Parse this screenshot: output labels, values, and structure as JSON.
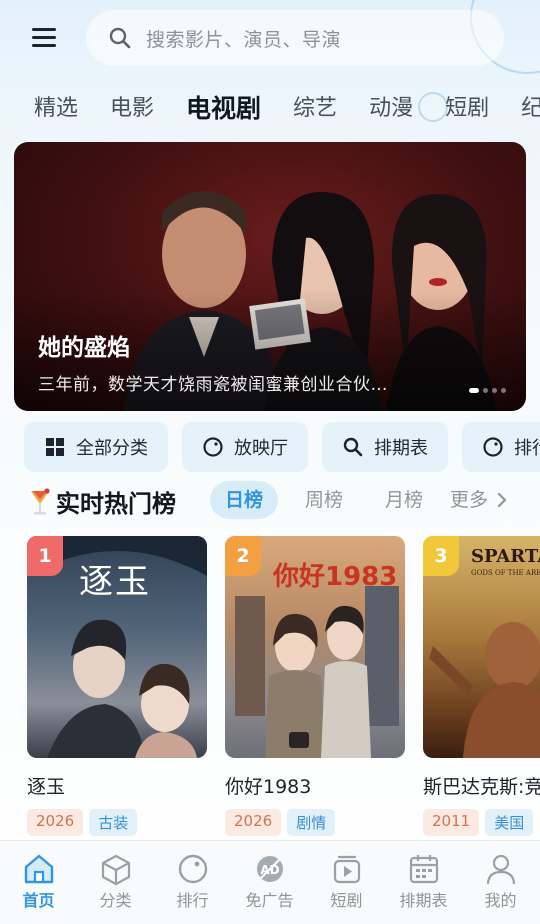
{
  "header": {
    "search_placeholder": "搜索影片、演员、导演"
  },
  "tabs": [
    {
      "label": "精选",
      "active": false
    },
    {
      "label": "电影",
      "active": false
    },
    {
      "label": "电视剧",
      "active": true
    },
    {
      "label": "综艺",
      "active": false
    },
    {
      "label": "动漫",
      "active": false
    },
    {
      "label": "短剧",
      "active": false
    },
    {
      "label": "纪录片",
      "active": false
    }
  ],
  "banner": {
    "title": "她的盛焰",
    "description": "三年前，数学天才饶雨瓷被闺蜜兼创业合伙…",
    "slide_count": 5,
    "active_slide": 1
  },
  "quick_links": [
    {
      "label": "全部分类",
      "icon": "grid-icon"
    },
    {
      "label": "放映厅",
      "icon": "circle-icon"
    },
    {
      "label": "排期表",
      "icon": "search-icon"
    },
    {
      "label": "排行榜",
      "icon": "circle-icon"
    }
  ],
  "hot_list": {
    "title": "实时热门榜",
    "tabs": [
      {
        "label": "日榜",
        "active": true
      },
      {
        "label": "周榜",
        "active": false
      },
      {
        "label": "月榜",
        "active": false
      }
    ],
    "more_label": "更多",
    "items": [
      {
        "rank": "1",
        "title": "逐玉",
        "year": "2026",
        "genre": "古装",
        "poster_text": "逐玉",
        "badge_color": "#f06a6a"
      },
      {
        "rank": "2",
        "title": "你好1983",
        "year": "2026",
        "genre": "剧情",
        "poster_text": "你好1983",
        "badge_color": "#f2a040"
      },
      {
        "rank": "3",
        "title": "斯巴达克斯:竞技场之神",
        "year": "2011",
        "genre": "美国",
        "poster_text": "SPARTACUS",
        "poster_sub": "GODS OF THE ARENA",
        "badge_color": "#f0c83a"
      }
    ]
  },
  "bottom_nav": [
    {
      "label": "首页",
      "icon": "home-icon",
      "active": true
    },
    {
      "label": "分类",
      "icon": "cube-icon",
      "active": false
    },
    {
      "label": "排行",
      "icon": "rank-icon",
      "active": false
    },
    {
      "label": "免广告",
      "icon": "no-ads-icon",
      "active": false
    },
    {
      "label": "短剧",
      "icon": "short-drama-icon",
      "active": false
    },
    {
      "label": "排期表",
      "icon": "calendar-icon",
      "active": false
    },
    {
      "label": "我的",
      "icon": "user-icon",
      "active": false
    }
  ],
  "colors": {
    "accent": "#2f97dd",
    "year_tag_text": "#d0754f",
    "genre_tag_text": "#3891d4"
  }
}
